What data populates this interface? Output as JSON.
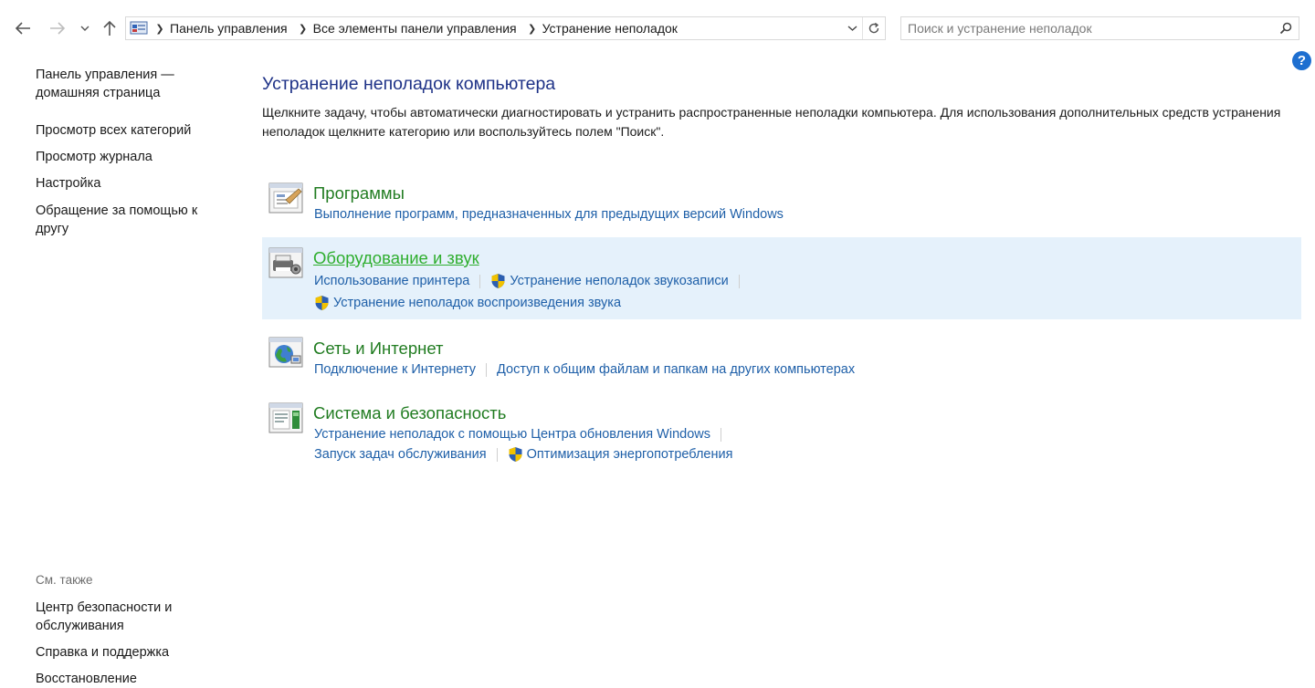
{
  "nav": {
    "breadcrumbs": [
      "Панель управления",
      "Все элементы панели управления",
      "Устранение неполадок"
    ],
    "search_placeholder": "Поиск и устранение неполадок"
  },
  "help_icon_label": "?",
  "left_pane": {
    "home": "Панель управления — домашняя страница",
    "items": [
      "Просмотр всех категорий",
      "Просмотр журнала",
      "Настройка",
      "Обращение за помощью к другу"
    ],
    "see_also_label": "См. также",
    "see_also": [
      "Центр безопасности и обслуживания",
      "Справка и поддержка",
      "Восстановление"
    ]
  },
  "main": {
    "title": "Устранение неполадок компьютера",
    "description": "Щелкните задачу, чтобы автоматически диагностировать и устранить распространенные неполадки компьютера. Для использования дополнительных средств устранения неполадок щелкните категорию или воспользуйтесь полем \"Поиск\".",
    "categories": [
      {
        "title": "Программы",
        "icon": "programs-icon",
        "links": [
          "Выполнение программ, предназначенных для предыдущих версий Windows"
        ]
      },
      {
        "title": "Оборудование и звук",
        "icon": "hardware-sound-icon",
        "links": [
          "Использование принтера",
          "Устранение неполадок звукозаписи",
          "Устранение неполадок воспроизведения звука"
        ]
      },
      {
        "title": "Сеть и Интернет",
        "icon": "network-internet-icon",
        "links": [
          "Подключение к Интернету",
          "Доступ к общим файлам и папкам на других компьютерах"
        ]
      },
      {
        "title": "Система и безопасность",
        "icon": "system-security-icon",
        "links": [
          "Устранение неполадок с помощью Центра обновления Windows",
          "Запуск задач обслуживания",
          "Оптимизация энергопотребления"
        ]
      }
    ]
  },
  "colors": {
    "title_blue": "#1e3287",
    "category_green": "#217c21",
    "category_hover_green": "#2fae2f",
    "link_blue": "#1e5fa8",
    "highlight_bg": "#e5f1fb"
  }
}
